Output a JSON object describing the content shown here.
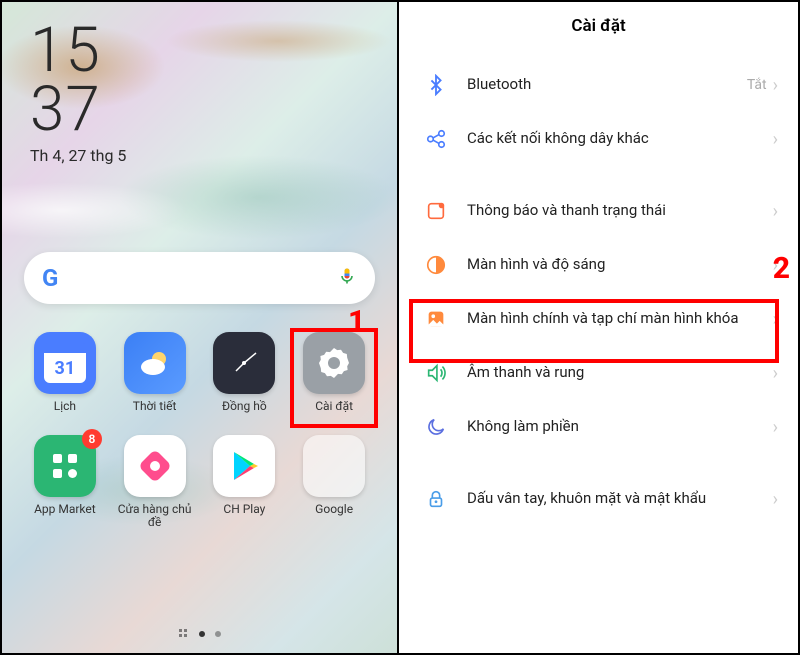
{
  "homescreen": {
    "clock_time_line1": "15",
    "clock_time_line2": "37",
    "clock_date": "Th 4, 27 thg 5",
    "apps_row1": [
      {
        "label": "Lịch",
        "bg": "#4a7dff",
        "text": "31"
      },
      {
        "label": "Thời tiết",
        "bg": "#3b7ff5"
      },
      {
        "label": "Đồng hồ",
        "bg": "#2a2d3a"
      },
      {
        "label": "Cài đặt",
        "bg": "#9aa0a6"
      }
    ],
    "apps_row2": [
      {
        "label": "App Market",
        "bg": "#2bb673",
        "badge": "8"
      },
      {
        "label": "Cửa hàng chủ đề",
        "bg": "#ffffff"
      },
      {
        "label": "CH Play",
        "bg": "#ffffff"
      },
      {
        "label": "Google",
        "bg": "folder"
      }
    ]
  },
  "settings": {
    "title": "Cài đặt",
    "items": [
      {
        "label": "Bluetooth",
        "status": "Tắt",
        "icon": "bluetooth",
        "color": "#4a7dff"
      },
      {
        "label": "Các kết nối không dây khác",
        "icon": "connections",
        "color": "#4a7dff"
      },
      {
        "label": "Thông báo và thanh trạng thái",
        "icon": "notify",
        "color": "#ff6a3d"
      },
      {
        "label": "Màn hình và độ sáng",
        "icon": "brightness",
        "color": "#ff8a3d"
      },
      {
        "label": "Màn hình chính và tạp chí màn hình khóa",
        "icon": "homescreen",
        "color": "#ff8a3d"
      },
      {
        "label": "Âm thanh và rung",
        "icon": "sound",
        "color": "#2bb673"
      },
      {
        "label": "Không làm phiền",
        "icon": "dnd",
        "color": "#5b6fe0"
      },
      {
        "label": "Dấu vân tay, khuôn mặt và mật khẩu",
        "icon": "security",
        "color": "#4a9de8"
      }
    ]
  },
  "annotations": {
    "one": "1",
    "two": "2"
  }
}
